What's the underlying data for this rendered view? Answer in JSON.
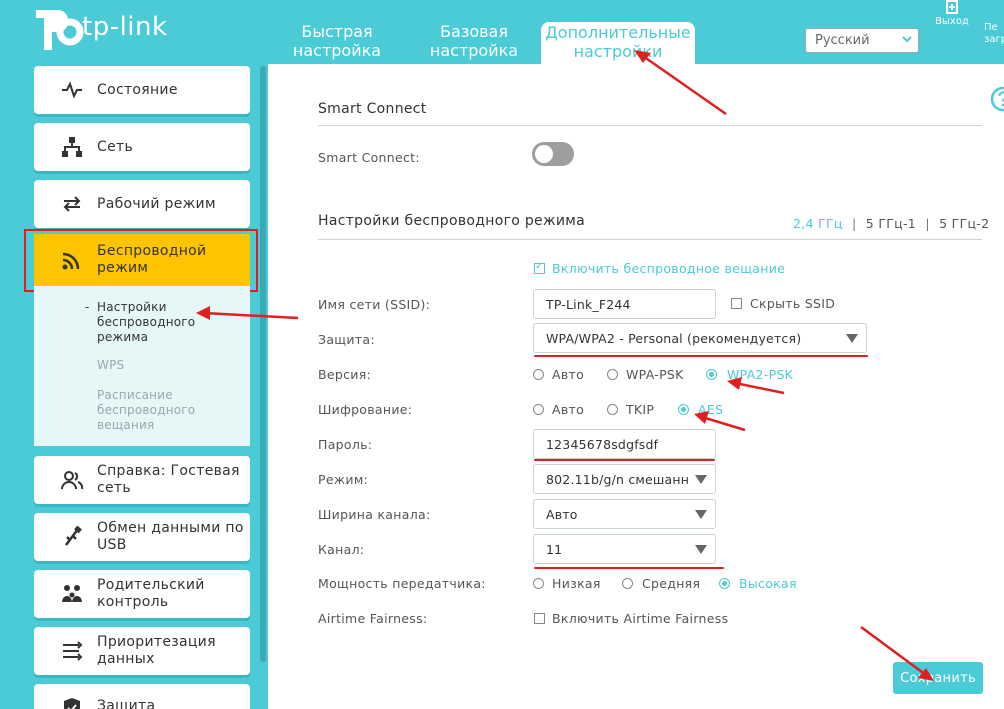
{
  "header": {
    "logo_text": "tp-link",
    "tabs": [
      {
        "line1": "Быстрая",
        "line2": "настройка"
      },
      {
        "line1": "Базовая",
        "line2": "настройка"
      },
      {
        "line1": "Дополнительные",
        "line2": "настройки"
      }
    ],
    "language": "Русский",
    "logout_label": "Выход",
    "reboot_label_line1": "Пе",
    "reboot_label_line2": "загр"
  },
  "sidebar": {
    "items": {
      "status": "Состояние",
      "network": "Сеть",
      "mode": "Рабочий режим",
      "wireless_line1": "Беспроводной",
      "wireless_line2": "режим",
      "guest_line1": "Справка: Гостевая",
      "guest_line2": "сеть",
      "usb_line1": "Обмен данными по",
      "usb_line2": "USB",
      "parental_line1": "Родительский",
      "parental_line2": "контроль",
      "qos_line1": "Приоритезация",
      "qos_line2": "данных",
      "security": "Защита"
    },
    "submenu": {
      "settings_line1": "Настройки",
      "settings_line2": "беспроводного",
      "settings_line3": "режима",
      "wps": "WPS",
      "schedule_line1": "Расписание",
      "schedule_line2": "беспроводного",
      "schedule_line3": "вещания",
      "dash": "-"
    }
  },
  "main": {
    "smart_connect": {
      "title": "Smart Connect",
      "label": "Smart Connect:",
      "enabled": false
    },
    "wireless": {
      "title": "Настройки беспроводного режима",
      "bands": [
        "2,4 ГГц",
        "5 ГГц-1",
        "5 ГГц-2"
      ],
      "band_separator": "|",
      "enable_broadcast": "Включить беспроводное вещание",
      "ssid_label": "Имя сети (SSID):",
      "ssid_value": "TP-Link_F244",
      "hide_ssid": "Скрыть SSID",
      "security_label": "Защита:",
      "security_value": "WPA/WPA2 - Personal (рекомендуется)",
      "version_label": "Версия:",
      "version_options": [
        "Авто",
        "WPA-PSK",
        "WPA2-PSK"
      ],
      "encryption_label": "Шифрование:",
      "encryption_options": [
        "Авто",
        "TKIP",
        "AES"
      ],
      "password_label": "Пароль:",
      "password_value": "12345678sdgfsdf",
      "mode_label": "Режим:",
      "mode_value": "802.11b/g/n смешанн",
      "width_label": "Ширина канала:",
      "width_value": "Авто",
      "channel_label": "Канал:",
      "channel_value": "11",
      "power_label": "Мощность передатчика:",
      "power_options": [
        "Низкая",
        "Средняя",
        "Высокая"
      ],
      "airtime_label": "Airtime Fairness:",
      "airtime_option": "Включить Airtime Fairness"
    },
    "save_label": "Сохранить",
    "check_mark": "✓"
  },
  "colors": {
    "brand": "#4acbd6",
    "active_nav": "#fdc500",
    "annotation": "#e02020"
  }
}
